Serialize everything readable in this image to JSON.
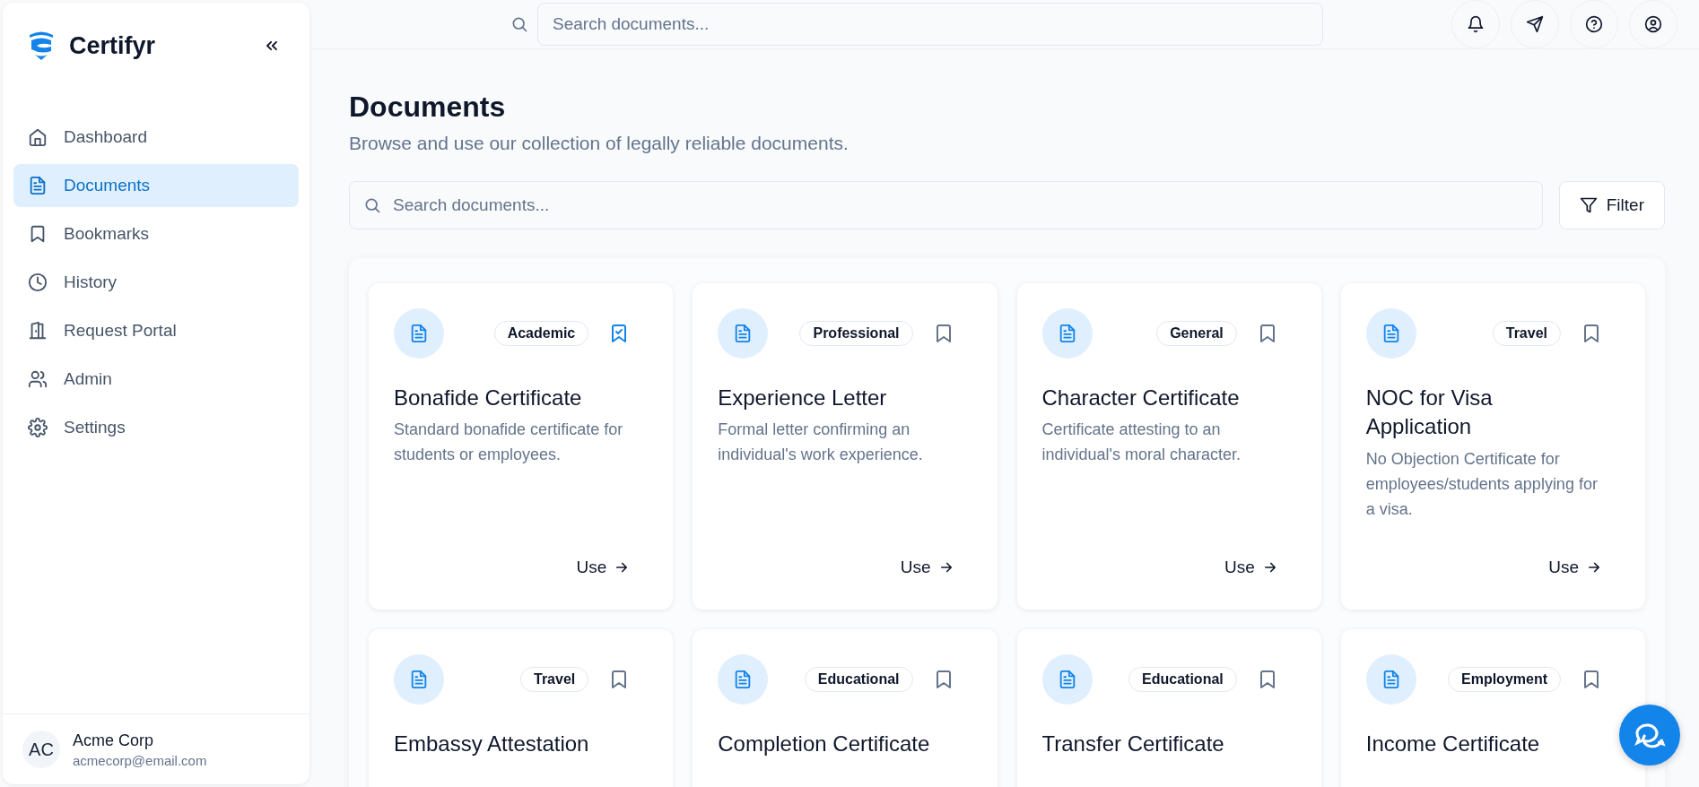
{
  "sidebar": {
    "brand": "Certifyr",
    "items": [
      {
        "label": "Dashboard",
        "selected": false
      },
      {
        "label": "Documents",
        "selected": true
      },
      {
        "label": "Bookmarks",
        "selected": false
      },
      {
        "label": "History",
        "selected": false
      },
      {
        "label": "Request Portal",
        "selected": false
      },
      {
        "label": "Admin",
        "selected": false
      },
      {
        "label": "Settings",
        "selected": false
      }
    ],
    "user": {
      "initials": "AC",
      "name": "Acme Corp",
      "email": "acmecorp@email.com"
    }
  },
  "header": {
    "search": {
      "placeholder": "Search documents..."
    }
  },
  "page": {
    "title": "Documents",
    "subtitle": "Browse and use our collection of legally reliable documents.",
    "search": {
      "placeholder": "Search documents..."
    },
    "filter_button": "Filter"
  },
  "documents": [
    {
      "tag": "Academic",
      "title": "Bonafide Certificate",
      "description": "Standard bonafide certificate for students or employees.",
      "bookmarked": true,
      "action": "Use"
    },
    {
      "tag": "Professional",
      "title": "Experience Letter",
      "description": "Formal letter confirming an individual's work experience.",
      "bookmarked": false,
      "action": "Use"
    },
    {
      "tag": "General",
      "title": "Character Certificate",
      "description": "Certificate attesting to an individual's moral character.",
      "bookmarked": false,
      "action": "Use"
    },
    {
      "tag": "Travel",
      "title": "NOC for Visa Application",
      "description": "No Objection Certificate for employees/students applying for a visa.",
      "bookmarked": false,
      "action": "Use"
    },
    {
      "tag": "Travel",
      "title": "Embassy Attestation",
      "bookmarked": false
    },
    {
      "tag": "Educational",
      "title": "Completion Certificate",
      "bookmarked": false
    },
    {
      "tag": "Educational",
      "title": "Transfer Certificate",
      "bookmarked": false
    },
    {
      "tag": "Employment",
      "title": "Income Certificate",
      "bookmarked": false
    }
  ]
}
